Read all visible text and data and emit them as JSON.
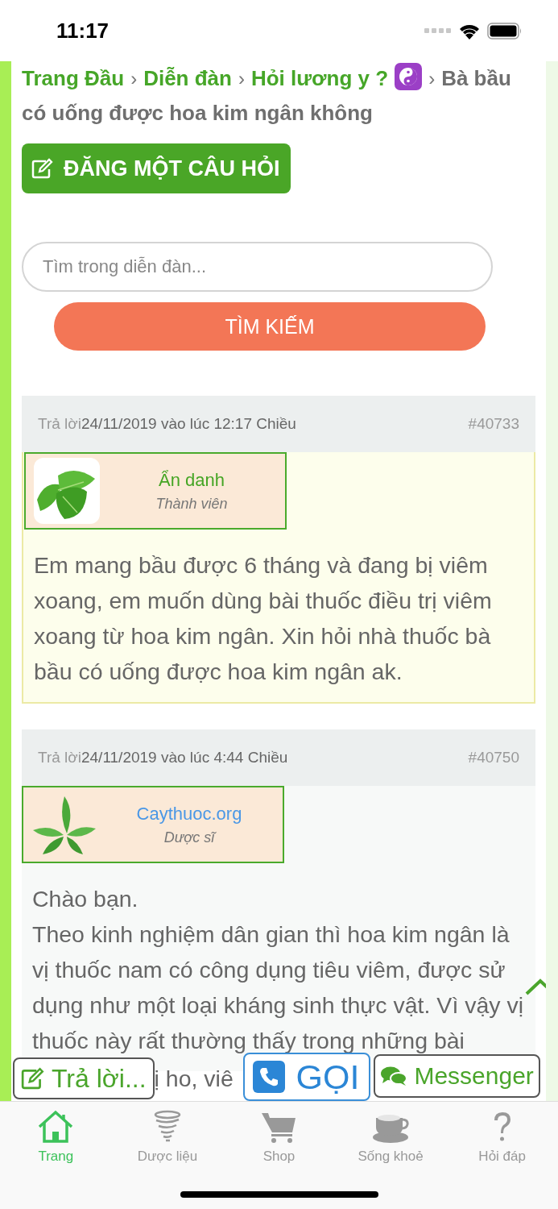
{
  "status_bar": {
    "time": "11:17"
  },
  "breadcrumb": {
    "links": [
      {
        "text": "Trang Đầu",
        "separator": "›"
      },
      {
        "text": "Diễn đàn",
        "separator": "›"
      },
      {
        "text": "Hỏi lương y ?",
        "separator": "›"
      }
    ],
    "current_lines": [
      "Bà bầu",
      "có uống được hoa kim ngân không"
    ]
  },
  "post_question_button": "ĐĂNG MỘT CÂU HỎI",
  "search": {
    "placeholder": "Tìm trong diễn đàn...",
    "button": "TÌM KIẾM"
  },
  "posts": [
    {
      "kind": "member",
      "label": "Trả lời",
      "date": "24/11/2019 vào lúc 12:17 Chiều",
      "number": "#40733",
      "author": "Ẩn danh",
      "role": "Thành viên",
      "paragraphs": [
        "Em mang bầu được 6 tháng và đang bị viêm xoang, em muốn dùng bài thuốc điều trị viêm xoang từ hoa kim ngân. Xin hỏi nhà thuốc bà bầu có uống được hoa kim ngân ak."
      ]
    },
    {
      "kind": "staff",
      "label": "Trả lời",
      "date": "24/11/2019 vào lúc 4:44 Chiều",
      "number": "#40750",
      "author": "Caythuoc.org",
      "role": "Dược sĩ",
      "paragraphs": [
        "Chào bạn.",
        "Theo kinh nghiệm dân gian thì hoa kim ngân là vị thuốc nam có công dụng tiêu viêm, được sử dụng như một loại kháng sinh thực vật. Vì vậy vị thuốc này rất thường thấy trong những bài"
      ]
    }
  ],
  "floating_bar": {
    "reply": "Trả lời...",
    "covered_text": "ị ho, viê",
    "call": "GỌI",
    "messenger": "Messenger"
  },
  "tabs": [
    {
      "label": "Trang",
      "selected": true
    },
    {
      "label": "Dược liệu",
      "selected": false
    },
    {
      "label": "Shop",
      "selected": false
    },
    {
      "label": "Sống khoẻ",
      "selected": false
    },
    {
      "label": "Hỏi đáp",
      "selected": false
    }
  ]
}
